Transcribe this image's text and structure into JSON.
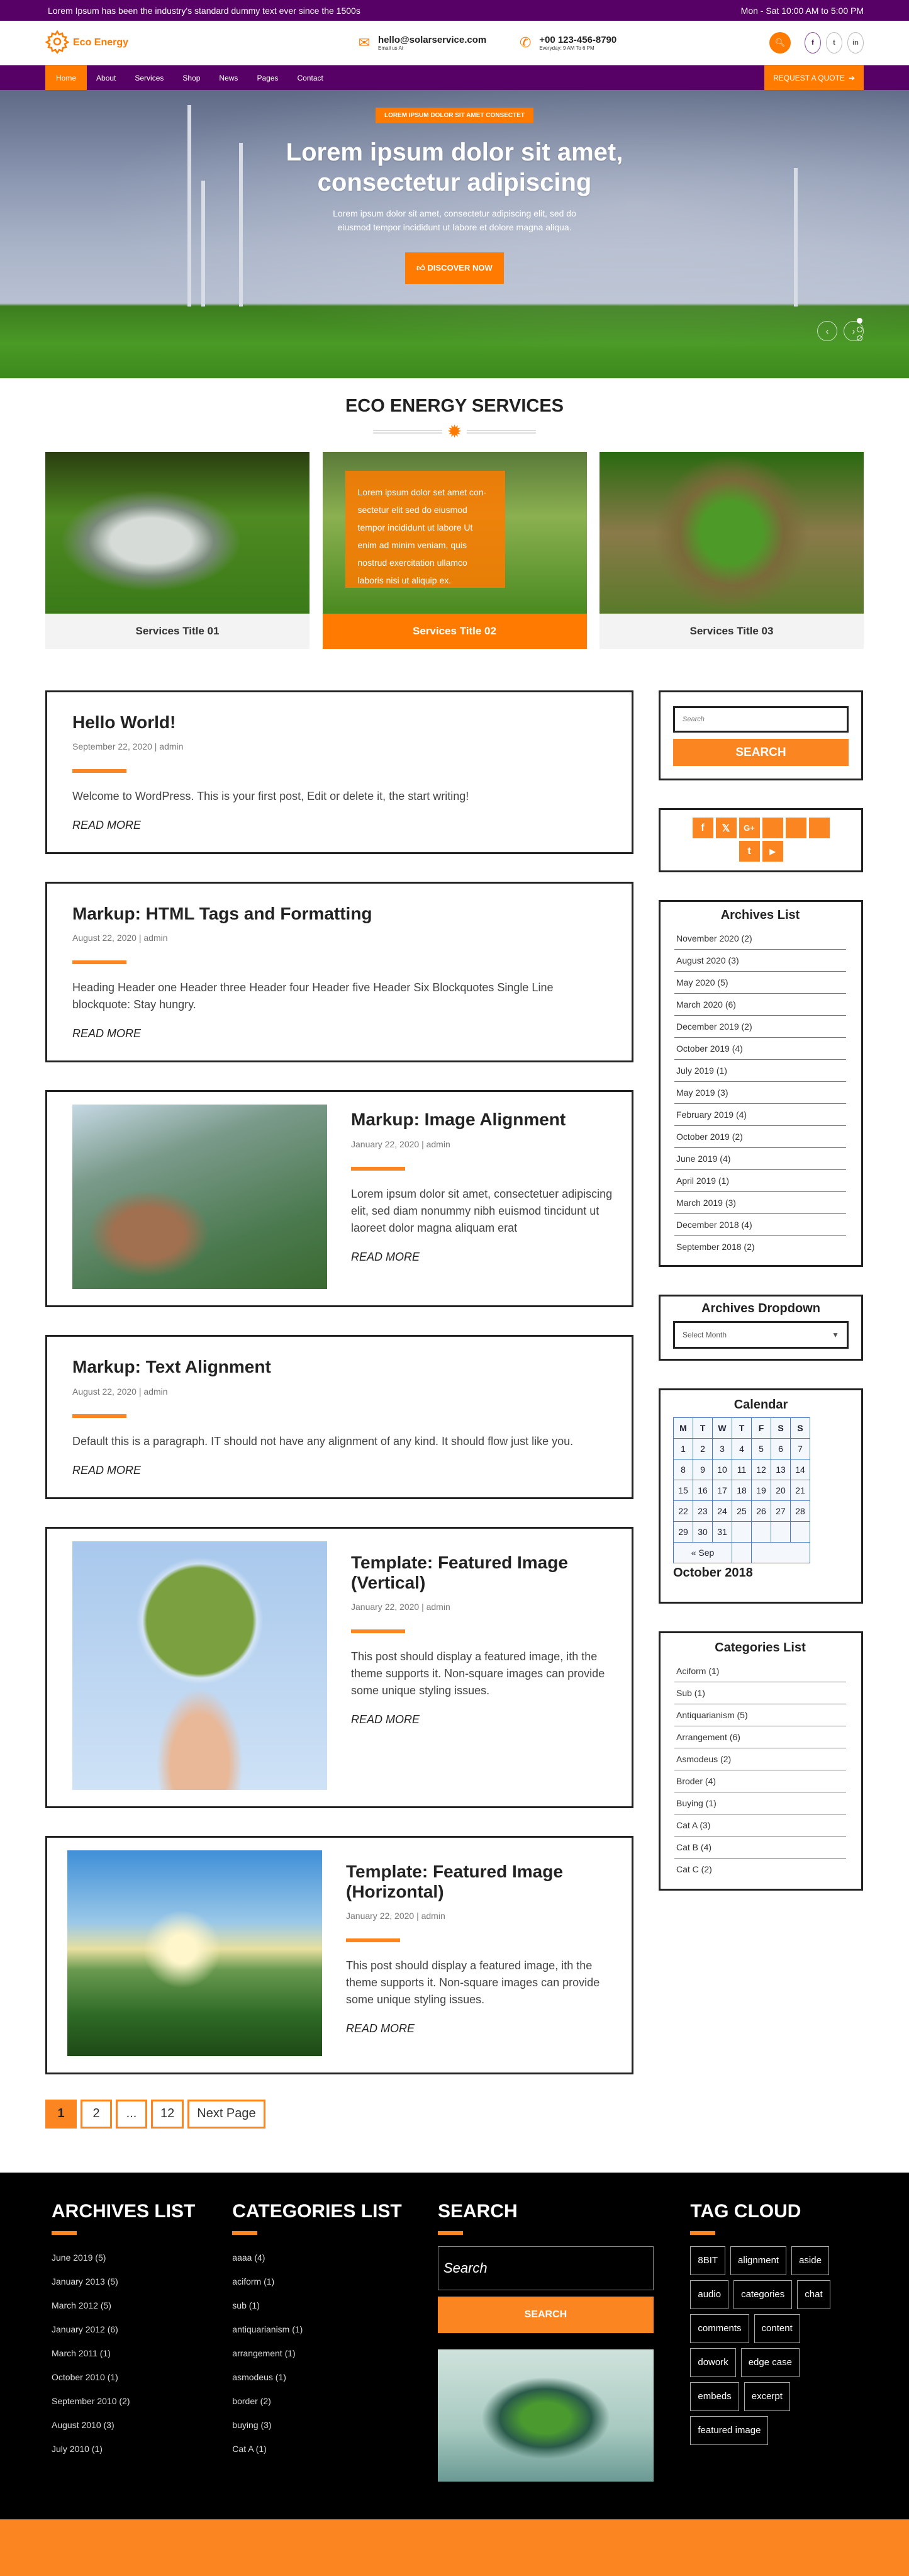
{
  "topbar": {
    "tagline": "Lorem Ipsum has been the industry's standard dummy text ever since the 1500s",
    "hours": "Mon - Sat 10:00 AM to 5:00 PM"
  },
  "header": {
    "logo_text": "Eco Energy",
    "email": "hello@solarservice.com",
    "email_sub": "Email us At",
    "phone": "+00 123-456-8790",
    "phone_sub": "Everyday: 9 AM To 6 PM",
    "social": [
      {
        "name": "facebook",
        "glyph": "f"
      },
      {
        "name": "twitter",
        "glyph": "t"
      },
      {
        "name": "linkedin",
        "glyph": "in"
      }
    ]
  },
  "nav": {
    "items": [
      "Home",
      "About",
      "Services",
      "Shop",
      "News",
      "Pages",
      "Contact"
    ],
    "active": "Home",
    "quote_label": "REQUEST A QUOTE"
  },
  "hero": {
    "tag": "LOREM IPSUM DOLOR SIT AMET CONSECTET",
    "title_line1": "Lorem ipsum dolor sit amet,",
    "title_line2": "consectetur adipiscing",
    "sub_line1": "Lorem ipsum dolor sit amet, consectetur adipiscing elit, sed do",
    "sub_line2": "eiusmod tempor incididunt ut labore et dolore magna aliqua.",
    "button": "DISCOVER NOW",
    "slides": 3,
    "active_slide": 1
  },
  "services": {
    "title": "ECO ENERGY SERVICES",
    "cards": [
      {
        "title": "Services Title 01",
        "active": false
      },
      {
        "title": "Services Title 02",
        "active": true,
        "overlay": "Lorem ipsum dolor set amet con-sectetur elit sed do eiusmod tempor incididunt ut labore Ut enim ad minim veniam, quis nostrud exercitation ullamco laboris nisi ut aliquip ex."
      },
      {
        "title": "Services Title 03",
        "active": false
      }
    ]
  },
  "posts": [
    {
      "title": "Hello World!",
      "meta": "September 22, 2020 | admin",
      "excerpt": "Welcome to WordPress. This is your first post, Edit or delete it, the start writing!",
      "more": "READ MORE"
    },
    {
      "title": "Markup: HTML Tags and Formatting",
      "meta": "August 22, 2020 | admin",
      "excerpt": "Heading Header one Header three Header four Header five Header Six Blockquotes Single Line blockquote: Stay hungry.",
      "more": "READ MORE"
    },
    {
      "title": "Markup: Image Alignment",
      "meta": "January 22, 2020 | admin",
      "excerpt": "Lorem ipsum dolor sit amet, consectetuer adipiscing elit, sed diam nonummy nibh euismod tincidunt ut laoreet dolor magna aliquam erat",
      "more": "READ MORE"
    },
    {
      "title": "Markup: Text Alignment",
      "meta": "August 22, 2020 | admin",
      "excerpt": "Default this is a paragraph. IT should not have any alignment of any kind. It should flow just like you.",
      "more": "READ MORE"
    },
    {
      "title": "Template: Featured Image (Vertical)",
      "meta": "January 22, 2020 | admin",
      "excerpt": "This post should display a featured image, ith the theme supports it. Non-square images can provide some unique styling issues.",
      "more": "READ MORE"
    },
    {
      "title": "Template: Featured Image (Horizontal)",
      "meta": "January 22, 2020 | admin",
      "excerpt": "This post should display a featured image, ith the theme supports it. Non-square images can provide some unique styling issues.",
      "more": "READ MORE"
    }
  ],
  "pagination": {
    "pages": [
      "1",
      "2",
      "...",
      "12"
    ],
    "current": "1",
    "next": "Next Page"
  },
  "sidebar": {
    "search_placeholder": "Search",
    "search_button": "SEARCH",
    "social": [
      {
        "name": "facebook",
        "glyph": "f"
      },
      {
        "name": "x-twitter",
        "glyph": "𝕏"
      },
      {
        "name": "google-plus",
        "glyph": "G+"
      },
      {
        "name": "blank-1",
        "glyph": ""
      },
      {
        "name": "blank-2",
        "glyph": ""
      },
      {
        "name": "blank-3",
        "glyph": ""
      },
      {
        "name": "tumblr",
        "glyph": "t"
      },
      {
        "name": "youtube",
        "glyph": "▶"
      }
    ],
    "archives_title": "Archives List",
    "archives": [
      "November 2020 (2)",
      "August 2020 (3)",
      "May 2020 (5)",
      "March 2020 (6)",
      "December 2019 (2)",
      "October 2019 (4)",
      "July 2019 (1)",
      "May 2019 (3)",
      "February 2019 (4)",
      "October 2019 (2)",
      "June 2019 (4)",
      "April 2019 (1)",
      "March 2019 (3)",
      "December 2018 (4)",
      "September 2018 (2)"
    ],
    "dropdown_title": "Archives Dropdown",
    "dropdown_value": "Select Month",
    "calendar_title": "Calendar",
    "calendar": {
      "headers": [
        "M",
        "T",
        "W",
        "T",
        "F",
        "S",
        "S"
      ],
      "weeks": [
        [
          "1",
          "2",
          "3",
          "4",
          "5",
          "6",
          "7"
        ],
        [
          "8",
          "9",
          "10",
          "11",
          "12",
          "13",
          "14"
        ],
        [
          "15",
          "16",
          "17",
          "18",
          "19",
          "20",
          "21"
        ],
        [
          "22",
          "23",
          "24",
          "25",
          "26",
          "27",
          "28"
        ],
        [
          "29",
          "30",
          "31",
          "",
          "",
          "",
          ""
        ]
      ],
      "prev": "« Sep",
      "caption": "October 2018"
    },
    "categories_title": "Categories List",
    "categories": [
      "Aciform (1)",
      "Sub (1)",
      "Antiquarianism (5)",
      "Arrangement (6)",
      "Asmodeus (2)",
      "Broder (4)",
      "Buying (1)",
      "Cat A (3)",
      "Cat B (4)",
      "Cat C (2)"
    ]
  },
  "footer": {
    "archives_title": "ARCHIVES LIST",
    "archives": [
      "June 2019 (5)",
      "January  2013 (5)",
      "March 2012 (5)",
      "January  2012 (6)",
      "March  2011 (1)",
      "October 2010 (1)",
      "September 2010 (2)",
      "August 2010 (3)",
      "July 2010 (1)"
    ],
    "categories_title": "CATEGORIES LIST",
    "categories": [
      "aaaa (4)",
      "aciform (1)",
      "sub (1)",
      "antiquarianism (1)",
      "arrangement (1)",
      "asmodeus (1)",
      "border (2)",
      "buying (3)",
      "Cat A (1)"
    ],
    "search_title": "SEARCH",
    "search_placeholder": "Search",
    "search_button": "SEARCH",
    "tags_title": "TAG CLOUD",
    "tags": [
      "8BIT",
      "alignment",
      "aside",
      "audio",
      "categories",
      "chat",
      "comments",
      "content",
      "dowork",
      "edge case",
      "embeds",
      "excerpt",
      "featured image"
    ]
  },
  "colors": {
    "brand_purple": "#570066",
    "accent_orange": "#ff7a00",
    "widget_orange": "#fb8520",
    "footer_bg": "#000000"
  }
}
